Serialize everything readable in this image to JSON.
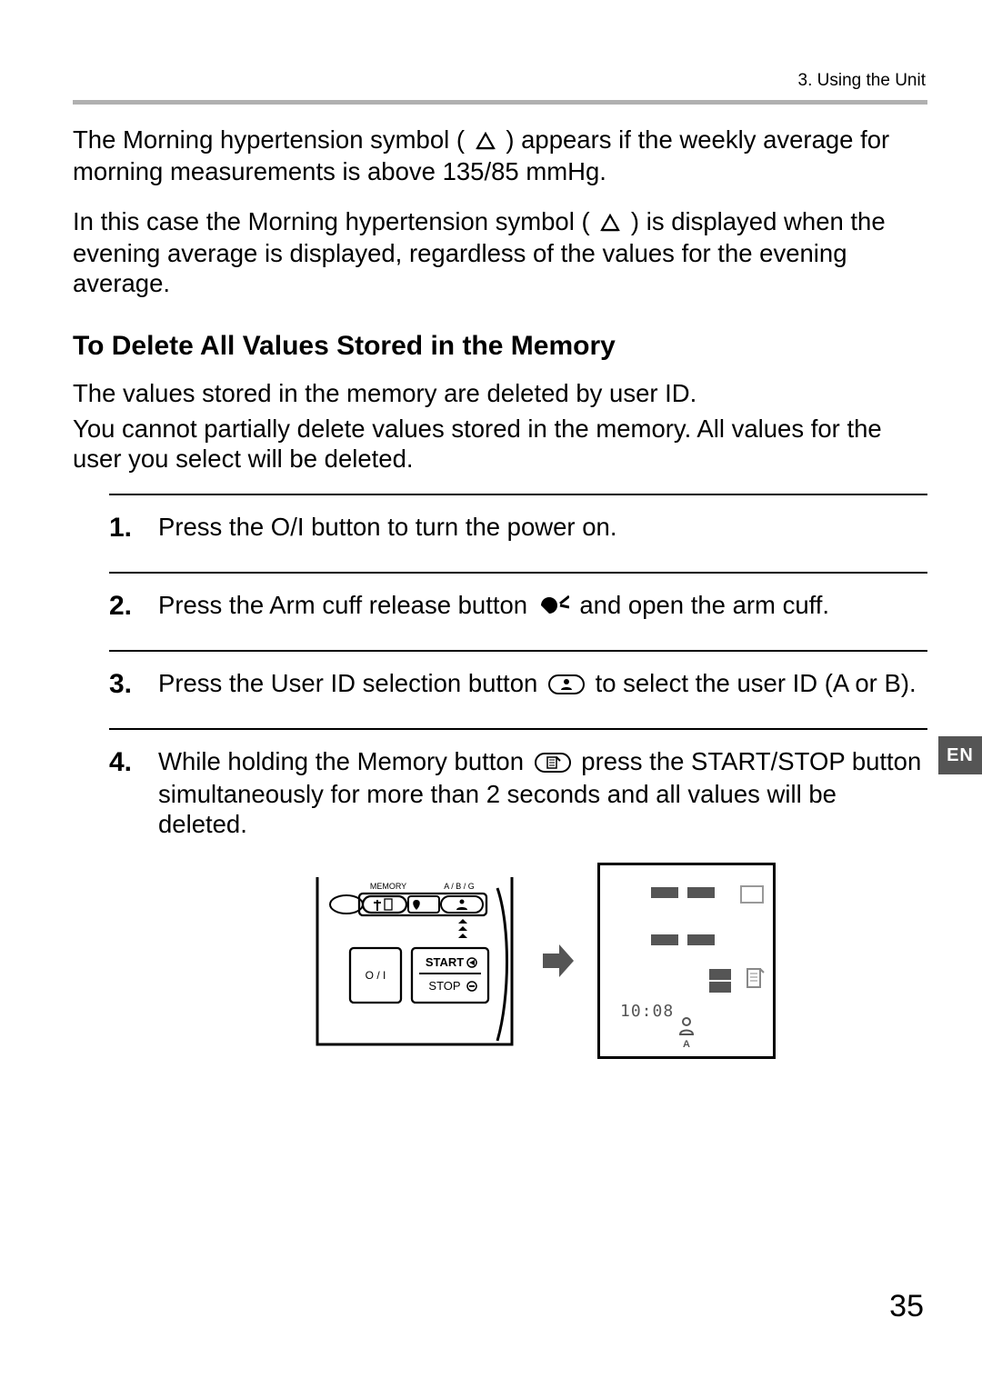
{
  "chapter": "3. Using the Unit",
  "p1_a": "The Morning hypertension symbol (",
  "p1_b": ") appears if the weekly average for morning measurements is above 135/85 mmHg.",
  "p2_a": "In this case the Morning hypertension symbol (",
  "p2_b": ") is displayed when the evening average is displayed, regardless of the values for the evening average.",
  "heading": "To Delete All Values Stored in the Memory",
  "p3": "The values stored in the memory are deleted by user ID.",
  "p4": "You cannot partially delete values stored in the memory. All values for the user you select will be deleted.",
  "steps": [
    {
      "num": "1.",
      "a": "Press the O/I button to turn the power on."
    },
    {
      "num": "2.",
      "a": "Press the Arm cuff release button ",
      "b": " and open the arm cuff."
    },
    {
      "num": "3.",
      "a": "Press the User ID selection button ",
      "b": " to select the user ID (A or B)."
    },
    {
      "num": "4.",
      "a": "While holding the Memory button ",
      "b": " press the START/STOP button simultaneously for more than 2 seconds and all values will be deleted."
    }
  ],
  "device_labels": {
    "memory": "MEMORY",
    "abg": "A / B / G",
    "oi": "O / I",
    "start": "START",
    "stop": "STOP"
  },
  "lcd_time": "10:08",
  "lcd_user": "A",
  "lang_tab": "EN",
  "page_number": "35"
}
